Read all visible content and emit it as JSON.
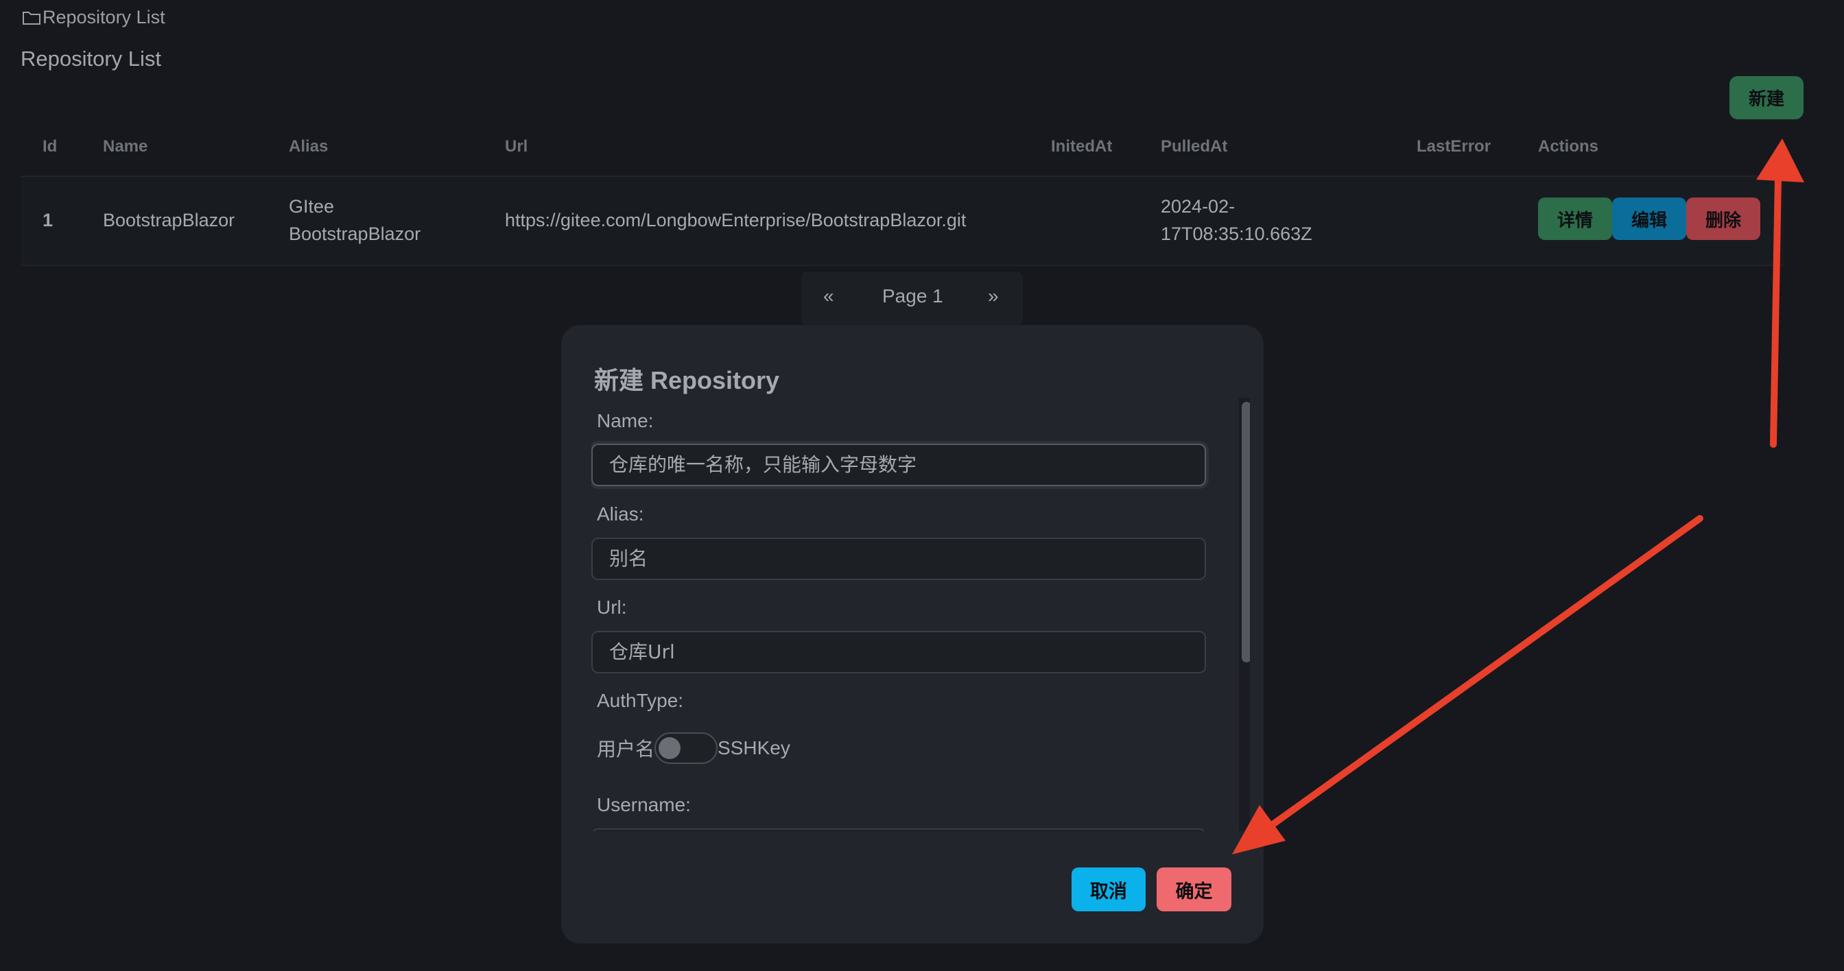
{
  "breadcrumb": {
    "icon": "folder-icon",
    "label": "Repository List"
  },
  "page_title": "Repository List",
  "toolbar": {
    "new_label": "新建"
  },
  "table": {
    "headers": [
      "Id",
      "Name",
      "Alias",
      "Url",
      "InitedAt",
      "PulledAt",
      "LastError",
      "Actions"
    ],
    "rows": [
      {
        "id": "1",
        "name": "BootstrapBlazor",
        "alias_line1": "GItee",
        "alias_line2": "BootstrapBlazor",
        "url": "https://gitee.com/LongbowEnterprise/BootstrapBlazor.git",
        "inited_at": "",
        "pulled_at_line1": "2024-02-",
        "pulled_at_line2": "17T08:35:10.663Z",
        "last_error": "",
        "actions": {
          "detail": "详情",
          "edit": "编辑",
          "delete": "删除"
        }
      }
    ]
  },
  "pagination": {
    "prev": "«",
    "page": "Page 1",
    "next": "»"
  },
  "modal": {
    "title": "新建 Repository",
    "fields": {
      "name_label": "Name:",
      "name_placeholder": "仓库的唯一名称，只能输入字母数字",
      "alias_label": "Alias:",
      "alias_placeholder": "别名",
      "url_label": "Url:",
      "url_placeholder": "仓库Url",
      "authtype_label": "AuthType:",
      "authtype_off_label": "用户名",
      "authtype_on_label": "SSHKey",
      "authtype_checked": false,
      "username_label": "Username:"
    },
    "cancel_label": "取消",
    "ok_label": "确定"
  },
  "colors": {
    "background": "#16181d",
    "new_button": "#2c6d4a",
    "detail_button": "#2c6d4a",
    "edit_button": "#0b6d9a",
    "delete_button": "#a63e45",
    "cancel_button": "#0ab1ea",
    "ok_button": "#ef6a6e",
    "annotation_arrow": "#e8402b"
  }
}
